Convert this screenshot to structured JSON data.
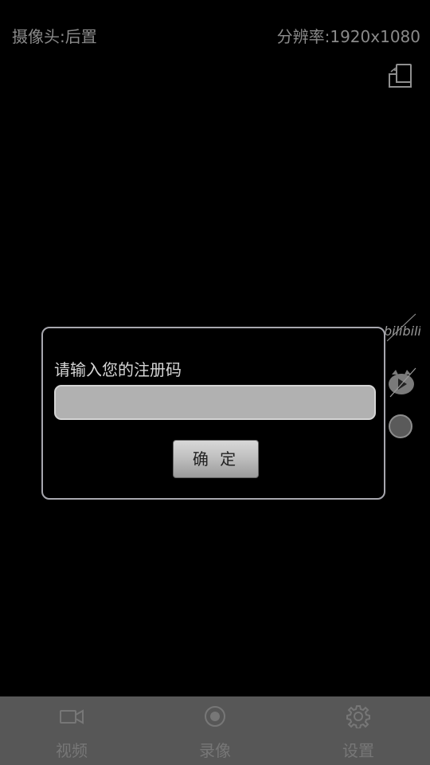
{
  "status": {
    "camera_text": "摄像头:后置",
    "resolution_text": "分辨率:1920x1080"
  },
  "side_controls": {
    "logo_icon": "bilibili-logo",
    "tv_icon": "bilibili-tv-icon",
    "record_icon": "record-dot-icon"
  },
  "dialog": {
    "title": "请输入您的注册码",
    "input_value": "",
    "input_placeholder": "",
    "confirm_label": "确 定"
  },
  "bottom_nav": {
    "items": [
      {
        "label": "视频",
        "icon": "video-camera-icon"
      },
      {
        "label": "录像",
        "icon": "record-icon"
      },
      {
        "label": "设置",
        "icon": "gear-icon"
      }
    ]
  },
  "colors": {
    "background": "#000000",
    "status_text": "#8a8a8a",
    "dialog_border": "#a7a7ae",
    "input_fill": "#b1b1b1",
    "nav_background": "#575757",
    "nav_text": "#777777"
  }
}
